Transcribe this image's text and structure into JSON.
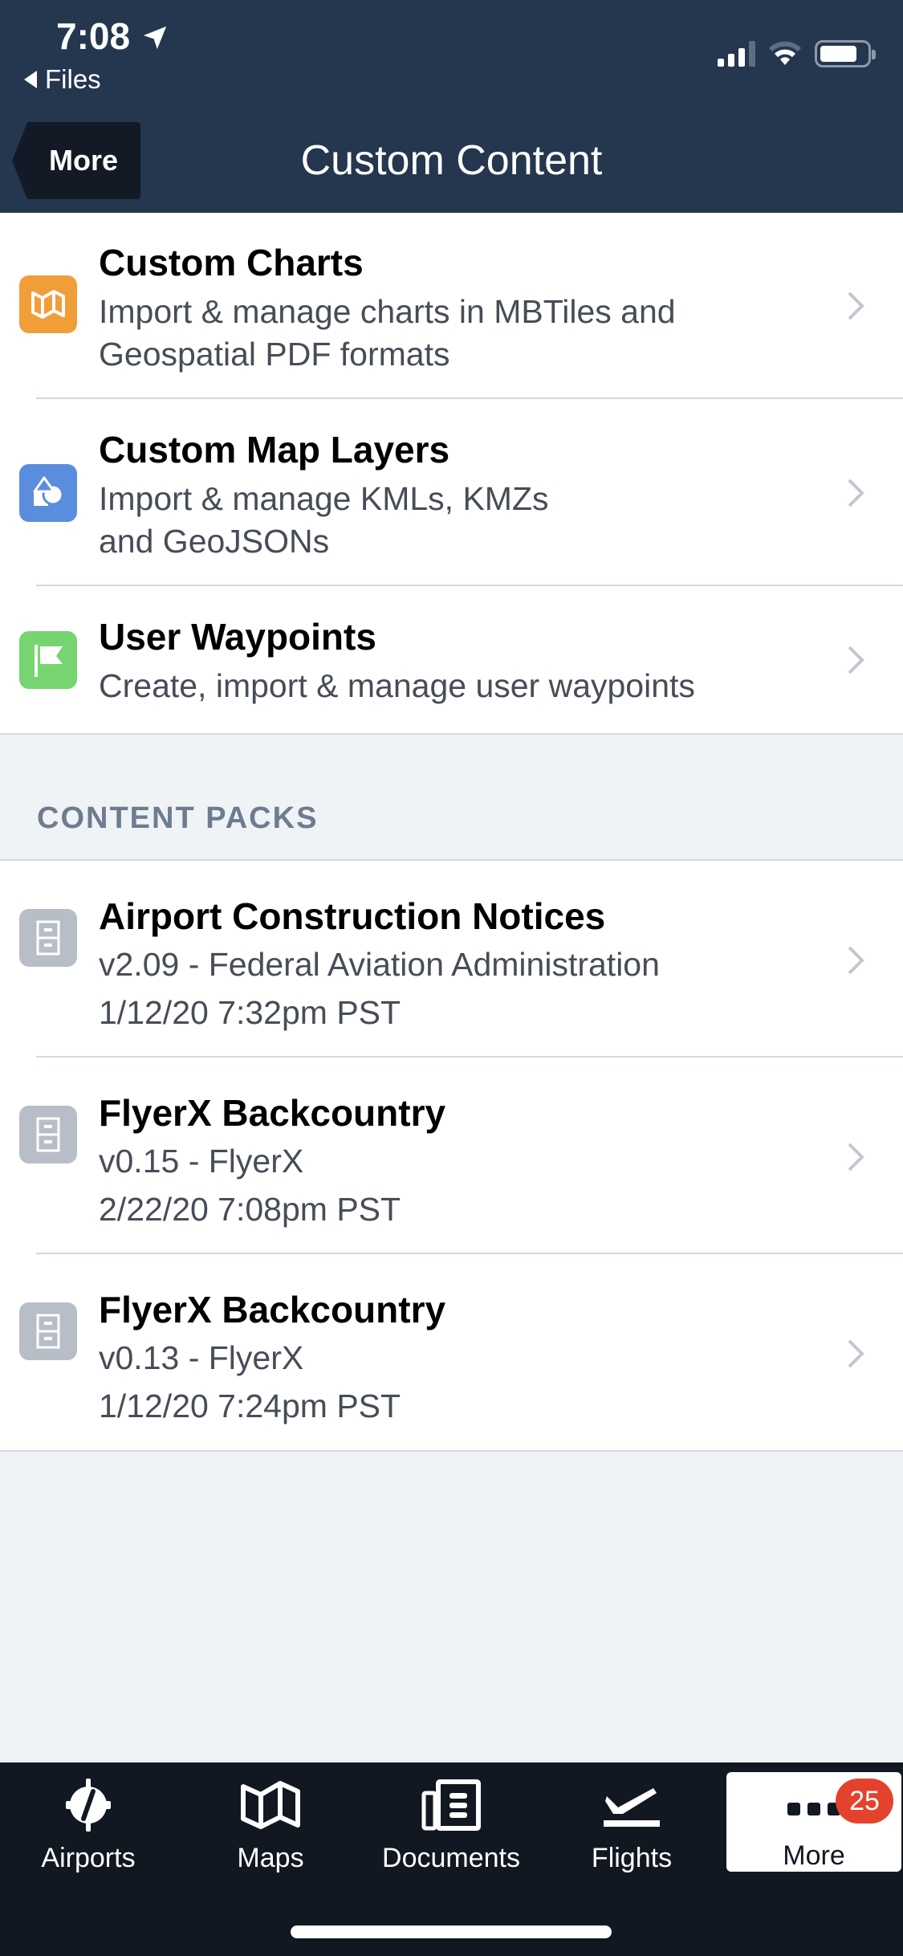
{
  "status_bar": {
    "time": "7:08",
    "back_app": "Files"
  },
  "nav": {
    "back_label": "More",
    "title": "Custom Content"
  },
  "custom_items": [
    {
      "title": "Custom Charts",
      "subtitle_lines": [
        "Import & manage charts in MBTiles and",
        "Geospatial PDF formats"
      ],
      "icon": "map-fold-icon",
      "color": "#f19d38"
    },
    {
      "title": "Custom Map Layers",
      "subtitle_lines": [
        "Import & manage KMLs, KMZs",
        "and GeoJSONs"
      ],
      "icon": "shapes-icon",
      "color": "#5b8ddf"
    },
    {
      "title": "User Waypoints",
      "subtitle_lines": [
        "Create, import & manage user waypoints"
      ],
      "icon": "flag-icon",
      "color": "#76d570"
    }
  ],
  "content_packs": {
    "section_label": "CONTENT PACKS",
    "items": [
      {
        "title": "Airport Construction Notices",
        "version_line": "v2.09 - Federal Aviation Administration",
        "date_line": "1/12/20 7:32pm PST"
      },
      {
        "title": "FlyerX Backcountry",
        "version_line": "v0.15 - FlyerX",
        "date_line": "2/22/20 7:08pm PST"
      },
      {
        "title": "FlyerX Backcountry",
        "version_line": "v0.13 - FlyerX",
        "date_line": "1/12/20 7:24pm PST"
      }
    ]
  },
  "tabbar": {
    "tabs": [
      {
        "label": "Airports",
        "icon": "airport-icon"
      },
      {
        "label": "Maps",
        "icon": "map-icon"
      },
      {
        "label": "Documents",
        "icon": "documents-icon"
      },
      {
        "label": "Flights",
        "icon": "flight-icon"
      },
      {
        "label": "More",
        "icon": "more-icon",
        "active": true,
        "badge": "25"
      }
    ]
  }
}
